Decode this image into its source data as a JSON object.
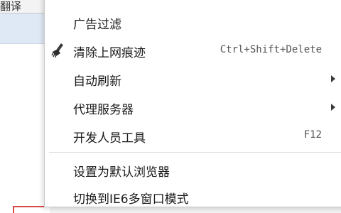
{
  "background": {
    "tab_title_fragment": "翻译"
  },
  "menu": {
    "items": [
      {
        "label": "广告过滤"
      },
      {
        "label": "清除上网痕迹",
        "shortcut": "Ctrl+Shift+Delete",
        "icon": "broom-icon"
      },
      {
        "label": "自动刷新",
        "submenu": true
      },
      {
        "label": "代理服务器",
        "submenu": true
      },
      {
        "label": "开发人员工具",
        "shortcut": "F12"
      },
      {
        "label": "设置为默认浏览器"
      },
      {
        "label": "切换到IE6多窗口模式"
      }
    ]
  },
  "colors": {
    "highlight_border": "#d84a4a",
    "menu_background": "#ffffff",
    "separator": "#dcdcdc"
  }
}
